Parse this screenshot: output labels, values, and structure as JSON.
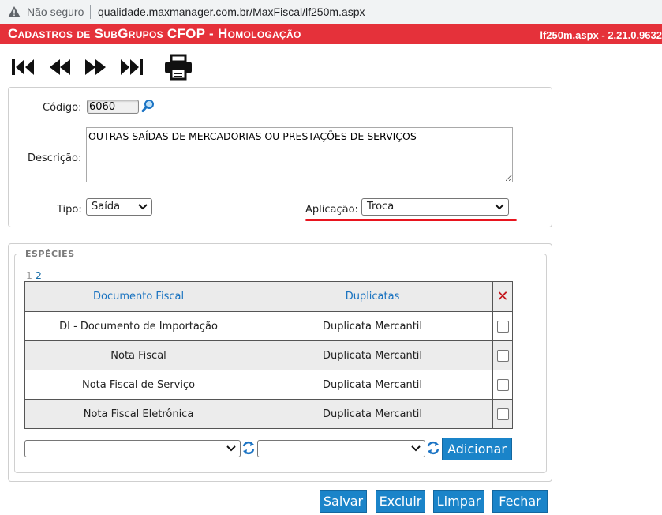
{
  "browser": {
    "security_label": "Não seguro",
    "url": "qualidade.maxmanager.com.br/MaxFiscal/lf250m.aspx"
  },
  "header": {
    "title": "Cadastros de SubGrupos CFOP  - Homologação",
    "version": "lf250m.aspx - 2.21.0.9632"
  },
  "form": {
    "codigo_label": "Código:",
    "codigo_value": "6060",
    "descricao_label": "Descrição:",
    "descricao_value": "OUTRAS SAÍDAS DE MERCADORIAS OU PRESTAÇÕES DE SERVIÇOS",
    "tipo_label": "Tipo:",
    "tipo_value": "Saída",
    "aplicacao_label": "Aplicação:",
    "aplicacao_value": "Troca"
  },
  "especies": {
    "legend": "ESPÉCIES",
    "pager_current": "1",
    "pager_next": "2",
    "col_documento": "Documento Fiscal",
    "col_duplicatas": "Duplicatas",
    "rows": [
      {
        "documento": "DI - Documento de Importação",
        "duplicata": "Duplicata Mercantil"
      },
      {
        "documento": "Nota Fiscal",
        "duplicata": "Duplicata Mercantil"
      },
      {
        "documento": "Nota Fiscal de Serviço",
        "duplicata": "Duplicata Mercantil"
      },
      {
        "documento": "Nota Fiscal Eletrônica",
        "duplicata": "Duplicata Mercantil"
      }
    ],
    "select_documento_value": "",
    "select_duplicata_value": "",
    "add_label": "Adicionar"
  },
  "actions": {
    "save": "Salvar",
    "delete": "Excluir",
    "clear": "Limpar",
    "close": "Fechar"
  },
  "colors": {
    "title_bg": "#e5313a",
    "button_bg": "#1a84c9",
    "header_text": "#1a73c0",
    "delete_x": "#c4161c"
  }
}
